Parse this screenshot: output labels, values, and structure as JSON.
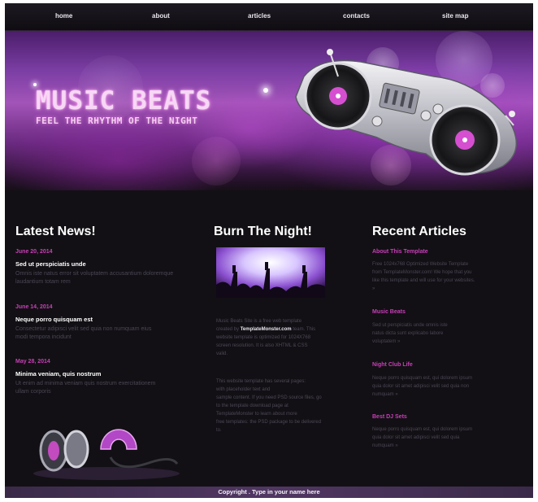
{
  "nav": {
    "items": [
      "home",
      "about",
      "articles",
      "contacts",
      "site map"
    ]
  },
  "header": {
    "logo_title": "MUSIC BEATS",
    "logo_tagline": "FEEL THE RHYTHM OF THE NIGHT"
  },
  "latest_news": {
    "title": "Latest News!",
    "items": [
      {
        "date": "June 20, 2014",
        "headline": "Sed ut perspiciatis unde",
        "text": [
          "Omnis iste natus error sit voluptatem accusantium doloremque",
          "laudantium totam rem"
        ]
      },
      {
        "date": "June 14, 2014",
        "headline": "Neque porro quisquam est",
        "text": [
          "Consectetur adipisci velit sed quia non numquam eius",
          "modi tempora incidunt"
        ]
      },
      {
        "date": "May 28, 2014",
        "headline": "Minima veniam, quis nostrum",
        "text": [
          "Ut enim ad minima veniam quis nostrum exercitationem",
          "ullam corporis"
        ]
      }
    ]
  },
  "burn_night": {
    "title": "Burn The Night!",
    "para1": [
      "Music Beats Site is a free web template",
      [
        "created by ",
        "TemplateMonster.com",
        " team. This"
      ],
      "website template is optimized for 1024X768",
      "screen resolution. It is also XHTML & CSS",
      "valid."
    ],
    "para2": [
      "This website template has several pages:",
      "with placeholder text and",
      "sample content. If you need PSD source files, go",
      "to the template download page at",
      "TemplateMonster to learn about more",
      "free templates: the PSD package to be delivered",
      "to."
    ]
  },
  "recent_articles": {
    "title": "Recent Articles",
    "items": [
      {
        "title": "About This Template",
        "text": [
          "Free 1024x768 Optimized Website Template",
          "from TemplateMonster.com! We hope that you",
          "like this template and will use for your websites.",
          "»"
        ]
      },
      {
        "title": "Music Beats",
        "text": [
          "Sed ut perspiciatis unde omnis iste",
          "natus dicta sunt explicabo labore",
          "voluptatem »"
        ]
      },
      {
        "title": "Night Club Life",
        "text": [
          "Neque porro quisquam est, qui dolorem ipsum",
          "quia dolor sit amet adipisci velit sed quia non",
          "numquam »"
        ]
      },
      {
        "title": "Best DJ Sets",
        "text": [
          "Neque porro quisquam est, qui dolorem ipsum",
          "quia dolor sit amet adipisci velit sed quia",
          "numquam »"
        ]
      }
    ]
  },
  "footer": {
    "text": "Copyright . Type in your name here"
  },
  "colors": {
    "accent": "#c83fb8",
    "background": "#121014",
    "banner_purple": "#7b3ea4"
  }
}
